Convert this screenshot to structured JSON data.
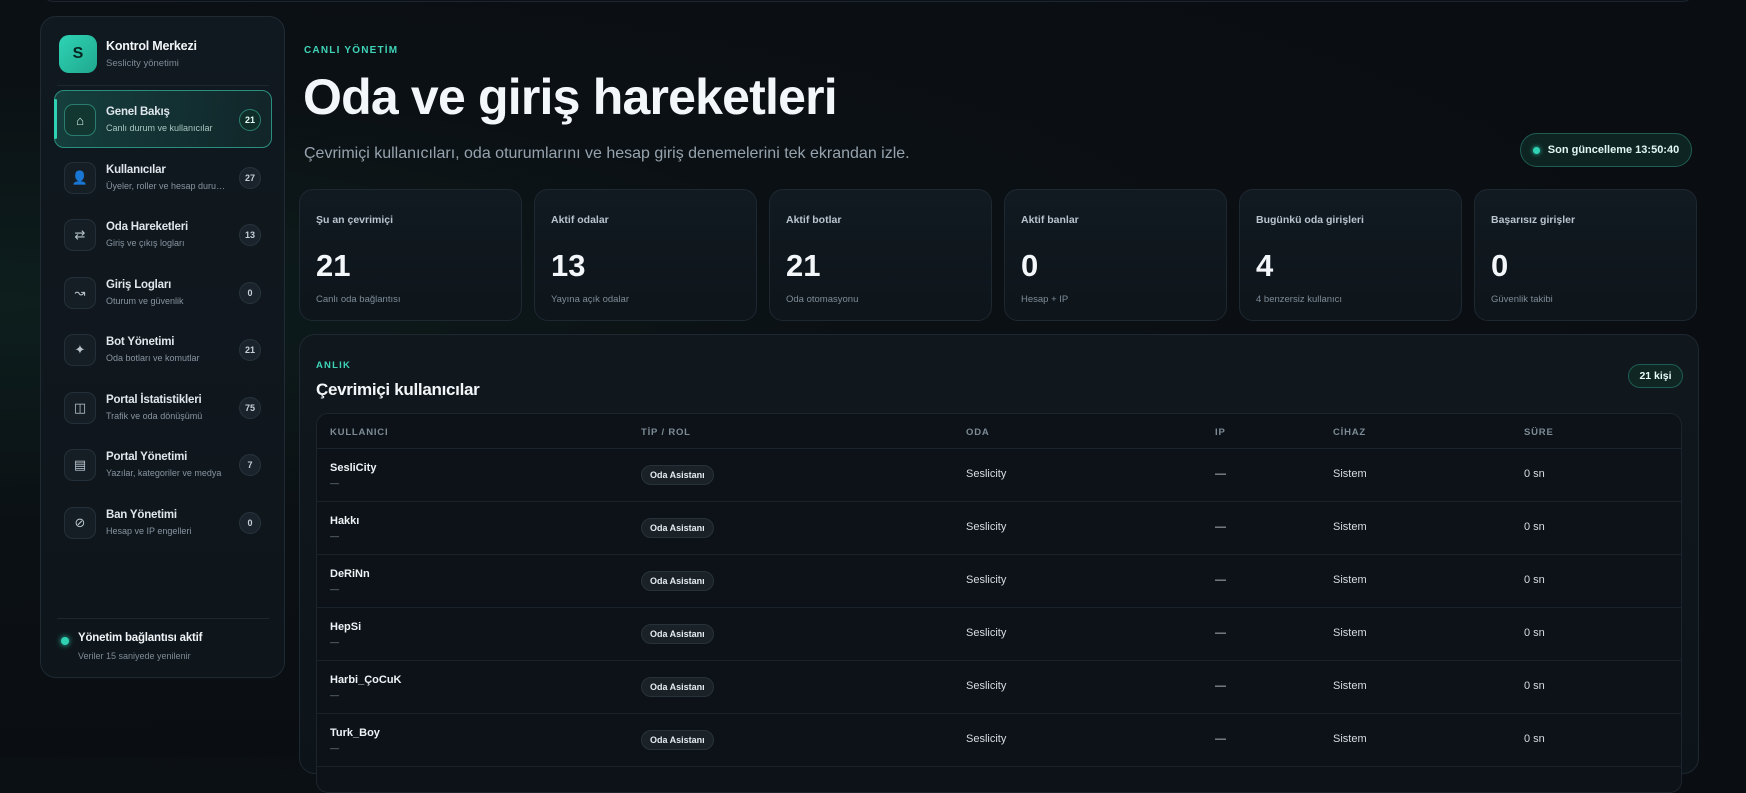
{
  "brand": {
    "logo": "S",
    "title": "Kontrol Merkezi",
    "subtitle": "Seslicity yönetimi"
  },
  "nav": [
    {
      "label": "Genel Bakış",
      "sub": "Canlı durum ve kullanıcılar",
      "count": "21",
      "icon": "home-icon",
      "glyph": "⌂",
      "active": true
    },
    {
      "label": "Kullanıcılar",
      "sub": "Üyeler, roller ve hesap durumları",
      "count": "27",
      "icon": "user-icon",
      "glyph": "👤",
      "active": false
    },
    {
      "label": "Oda Hareketleri",
      "sub": "Giriş ve çıkış logları",
      "count": "13",
      "icon": "swap-arrows-icon",
      "glyph": "⇄",
      "active": false
    },
    {
      "label": "Giriş Logları",
      "sub": "Oturum ve güvenlik",
      "count": "0",
      "icon": "login-icon",
      "glyph": "↝",
      "active": false
    },
    {
      "label": "Bot Yönetimi",
      "sub": "Oda botları ve komutlar",
      "count": "21",
      "icon": "sparkle-icon",
      "glyph": "✦",
      "active": false
    },
    {
      "label": "Portal İstatistikleri",
      "sub": "Trafik ve oda dönüşümü",
      "count": "75",
      "icon": "columns-icon",
      "glyph": "◫",
      "active": false
    },
    {
      "label": "Portal Yönetimi",
      "sub": "Yazılar, kategoriler ve medya",
      "count": "7",
      "icon": "document-icon",
      "glyph": "▤",
      "active": false
    },
    {
      "label": "Ban Yönetimi",
      "sub": "Hesap ve IP engelleri",
      "count": "0",
      "icon": "ban-icon",
      "glyph": "⊘",
      "active": false
    }
  ],
  "connection": {
    "title": "Yönetim bağlantısı aktif",
    "sub": "Veriler 15 saniyede yenilenir"
  },
  "header": {
    "eyebrow": "CANLI YÖNETİM",
    "title": "Oda ve giriş hareketleri",
    "description": "Çevrimiçi kullanıcıları, oda oturumlarını ve hesap giriş denemelerini tek ekrandan izle.",
    "updated": "Son güncelleme 13:50:40"
  },
  "stats": [
    {
      "label": "Şu an çevrimiçi",
      "value": "21",
      "sub": "Canlı oda bağlantısı"
    },
    {
      "label": "Aktif odalar",
      "value": "13",
      "sub": "Yayına açık odalar"
    },
    {
      "label": "Aktif botlar",
      "value": "21",
      "sub": "Oda otomasyonu"
    },
    {
      "label": "Aktif banlar",
      "value": "0",
      "sub": "Hesap + IP"
    },
    {
      "label": "Bugünkü oda girişleri",
      "value": "4",
      "sub": "4 benzersiz kullanıcı"
    },
    {
      "label": "Başarısız girişler",
      "value": "0",
      "sub": "Güvenlik takibi"
    }
  ],
  "online": {
    "eyebrow": "ANLIK",
    "title": "Çevrimiçi kullanıcılar",
    "badge": "21 kişi",
    "columns": [
      "KULLANICI",
      "TİP / ROL",
      "ODA",
      "IP",
      "CİHAZ",
      "SÜRE"
    ],
    "rows": [
      {
        "name": "SesliCity",
        "sub": "—",
        "role": "Oda Asistanı",
        "room": "Seslicity",
        "ip": "—",
        "device": "Sistem",
        "duration": "0 sn"
      },
      {
        "name": "Hakkı",
        "sub": "—",
        "role": "Oda Asistanı",
        "room": "Seslicity",
        "ip": "—",
        "device": "Sistem",
        "duration": "0 sn"
      },
      {
        "name": "DeRiNn",
        "sub": "—",
        "role": "Oda Asistanı",
        "room": "Seslicity",
        "ip": "—",
        "device": "Sistem",
        "duration": "0 sn"
      },
      {
        "name": "HepSi",
        "sub": "—",
        "role": "Oda Asistanı",
        "room": "Seslicity",
        "ip": "—",
        "device": "Sistem",
        "duration": "0 sn"
      },
      {
        "name": "Harbi_ÇoCuK",
        "sub": "—",
        "role": "Oda Asistanı",
        "room": "Seslicity",
        "ip": "—",
        "device": "Sistem",
        "duration": "0 sn"
      },
      {
        "name": "Turk_Boy",
        "sub": "—",
        "role": "Oda Asistanı",
        "room": "Seslicity",
        "ip": "—",
        "device": "Sistem",
        "duration": "0 sn"
      }
    ]
  },
  "colors": {
    "accent": "#2fd3b4",
    "background": "#0a0d11",
    "panel": "#10181e"
  }
}
